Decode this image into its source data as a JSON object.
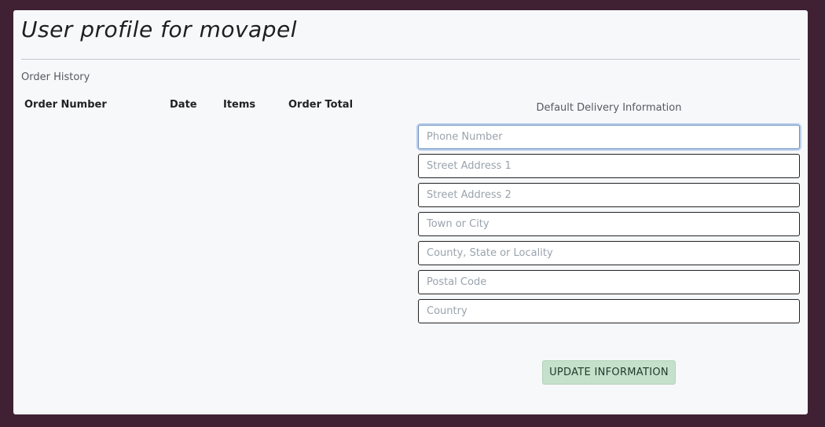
{
  "page": {
    "title": "User profile for movapel"
  },
  "order_history": {
    "label": "Order History",
    "columns": [
      "Order Number",
      "Date",
      "Items",
      "Order Total"
    ],
    "rows": []
  },
  "delivery": {
    "heading": "Default Delivery Information",
    "fields": [
      {
        "placeholder": "Phone Number",
        "value": ""
      },
      {
        "placeholder": "Street Address 1",
        "value": ""
      },
      {
        "placeholder": "Street Address 2",
        "value": ""
      },
      {
        "placeholder": "Town or City",
        "value": ""
      },
      {
        "placeholder": "County, State or Locality",
        "value": ""
      },
      {
        "placeholder": "Postal Code",
        "value": ""
      },
      {
        "placeholder": "Country",
        "value": ""
      }
    ],
    "submit_label": "UPDATE INFORMATION"
  },
  "colors": {
    "page_background": "#3f2133",
    "card_background": "#f7f8fa",
    "button_background": "#c5e1cb",
    "focus_ring": "#bcd0ec"
  }
}
